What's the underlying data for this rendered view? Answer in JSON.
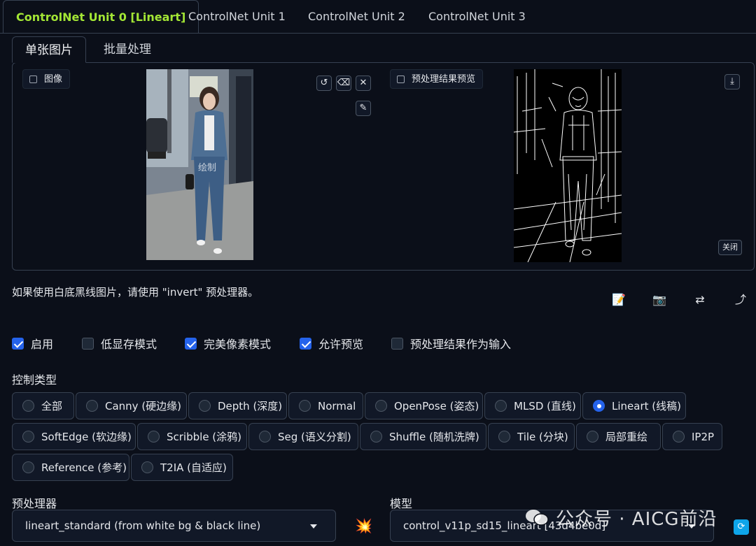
{
  "unit_tabs": [
    "ControlNet Unit 0 [Lineart]",
    "ControlNet Unit 1",
    "ControlNet Unit 2",
    "ControlNet Unit 3"
  ],
  "mode_tabs": [
    "单张图片",
    "批量处理"
  ],
  "image_label": "图像",
  "preview_label": "预处理结果预览",
  "close_label": "关闭",
  "photo_watermark": "绘制",
  "hint": "如果使用白底黑线图片，请使用 \"invert\" 预处理器。",
  "checkboxes": [
    {
      "label": "启用",
      "checked": true
    },
    {
      "label": "低显存模式",
      "checked": false
    },
    {
      "label": "完美像素模式",
      "checked": true
    },
    {
      "label": "允许预览",
      "checked": true
    },
    {
      "label": "预处理结果作为输入",
      "checked": false
    }
  ],
  "control_type_label": "控制类型",
  "control_types": [
    "全部",
    "Canny (硬边缘)",
    "Depth (深度)",
    "Normal",
    "OpenPose (姿态)",
    "MLSD (直线)",
    "Lineart (线稿)",
    "SoftEdge (软边缘)",
    "Scribble (涂鸦)",
    "Seg (语义分割)",
    "Shuffle (随机洗牌)",
    "Tile (分块)",
    "局部重绘",
    "IP2P",
    "Reference (参考)",
    "T2IA (自适应)"
  ],
  "selected_control_type": "Lineart (线稿)",
  "preprocessor_label": "预处理器",
  "preprocessor_value": "lineart_standard (from white bg & black line)",
  "model_label": "模型",
  "model_value": "control_v11p_sd15_lineart [43d4be0d]",
  "watermark_text": "公众号 · AICG前沿",
  "colors": {
    "active_tab": "#a3e635",
    "accent": "#2563eb",
    "background": "#0b0f19"
  }
}
